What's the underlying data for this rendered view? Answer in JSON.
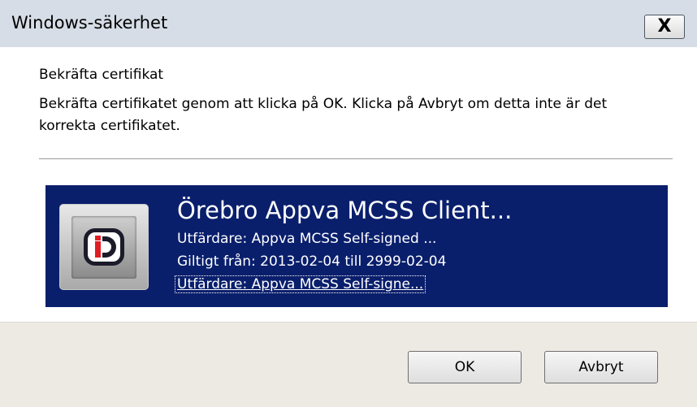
{
  "window": {
    "title": "Windows-säkerhet",
    "close_label": "X"
  },
  "dialog": {
    "heading": "Bekräfta certifikat",
    "description": "Bekräfta certifikatet genom att klicka på OK. Klicka på Avbryt om detta inte är det korrekta certifikatet."
  },
  "certificate": {
    "name": "Örebro Appva MCSS Client...",
    "issuer": "Utfärdare: Appva MCSS Self-signed ...",
    "validity": "Giltigt från: 2013-02-04 till 2999-02-04",
    "details_link": "Utfärdare: Appva MCSS Self-signe...",
    "icon": "appva-id-icon",
    "tile_color": "#0a1f6c"
  },
  "buttons": {
    "ok_label": "OK",
    "cancel_label": "Avbryt"
  }
}
